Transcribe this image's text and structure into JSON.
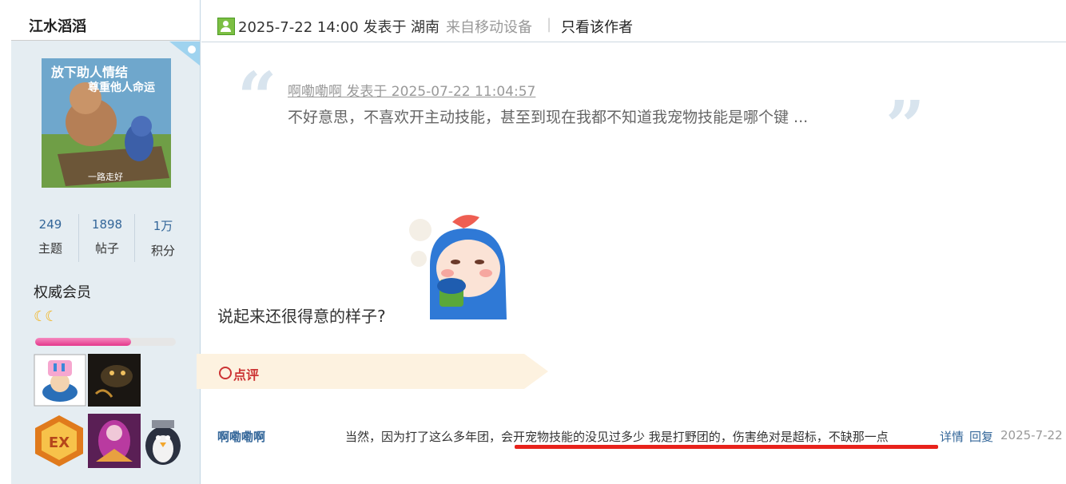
{
  "sidebar": {
    "username": "江水滔滔",
    "avatar_texts": [
      "放下助人情结",
      "尊重他人命运",
      "一路走好"
    ],
    "stats": [
      {
        "value": "249",
        "label": "主题"
      },
      {
        "value": "1898",
        "label": "帖子"
      },
      {
        "value": "1万",
        "label": "积分"
      }
    ],
    "rank": "权威会员",
    "moons": "☾☾",
    "progress": 0.68
  },
  "post": {
    "date": "2025-7-22 14:00 发表于",
    "location": "湖南",
    "device": "来自移动设备",
    "divider": "|",
    "only_author": "只看该作者",
    "quote": {
      "author_line": "啊嘞嘞啊 发表于 2025-07-22 11:04:57",
      "text": "不好意思，不喜欢开主动技能，甚至到现在我都不知道我宠物技能是哪个键 ..."
    },
    "reply": "说起来还很得意的样子?"
  },
  "comments": {
    "header": "点评",
    "items": [
      {
        "user": "啊嘞嘞啊",
        "text": "当然，因为打了这么多年团，会开宠物技能的没见过多少 我是打野团的，伤害绝对是超标，不缺那一点",
        "details": "详情",
        "reply": "回复",
        "date": "2025-7-22"
      }
    ]
  },
  "colors": {
    "sidebar_bg": "#e5edf2",
    "link": "#336699",
    "underline": "#e8221b",
    "comment_header": "#cc3333"
  }
}
